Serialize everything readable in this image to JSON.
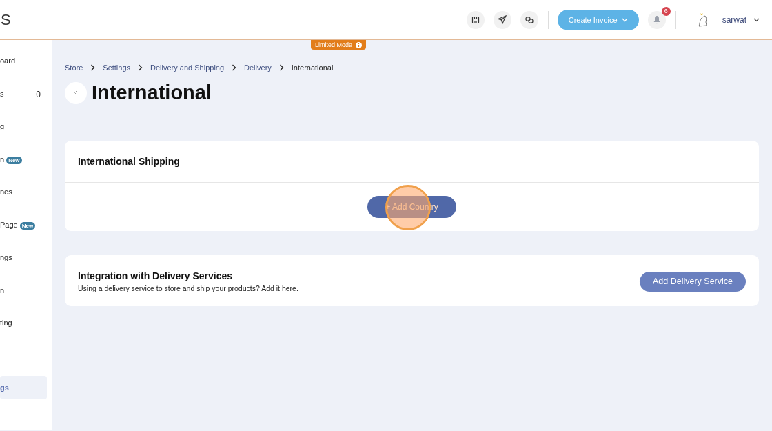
{
  "header": {
    "brand": "S",
    "create_button": "Create Invoice",
    "notifications": "6",
    "user": "sarwat"
  },
  "limited_mode": "Limited Mode",
  "sidebar": {
    "items": [
      {
        "label": "oard",
        "selected": false
      },
      {
        "label": "s",
        "count": "0",
        "selected": false
      },
      {
        "label": "g",
        "selected": false
      },
      {
        "label": "n",
        "badge": "New",
        "selected": false
      },
      {
        "label": "nes",
        "selected": false
      },
      {
        "label": "Page",
        "badge": "New",
        "selected": false
      },
      {
        "label": "ngs",
        "selected": false
      },
      {
        "label": "n",
        "selected": false
      },
      {
        "label": "ting",
        "selected": false
      },
      {
        "selected": false
      },
      {
        "label": "gs",
        "selected": true
      }
    ]
  },
  "breadcrumbs": [
    "Store",
    "Settings",
    "Delivery and Shipping",
    "Delivery",
    "International"
  ],
  "page_title": "International",
  "shipping_card": {
    "title": "International Shipping",
    "button": "+ Add Country"
  },
  "integration_card": {
    "title": "Integration with Delivery Services",
    "description": "Using a delivery service to store and ship your products? Add it here.",
    "button": "Add Delivery Service"
  }
}
